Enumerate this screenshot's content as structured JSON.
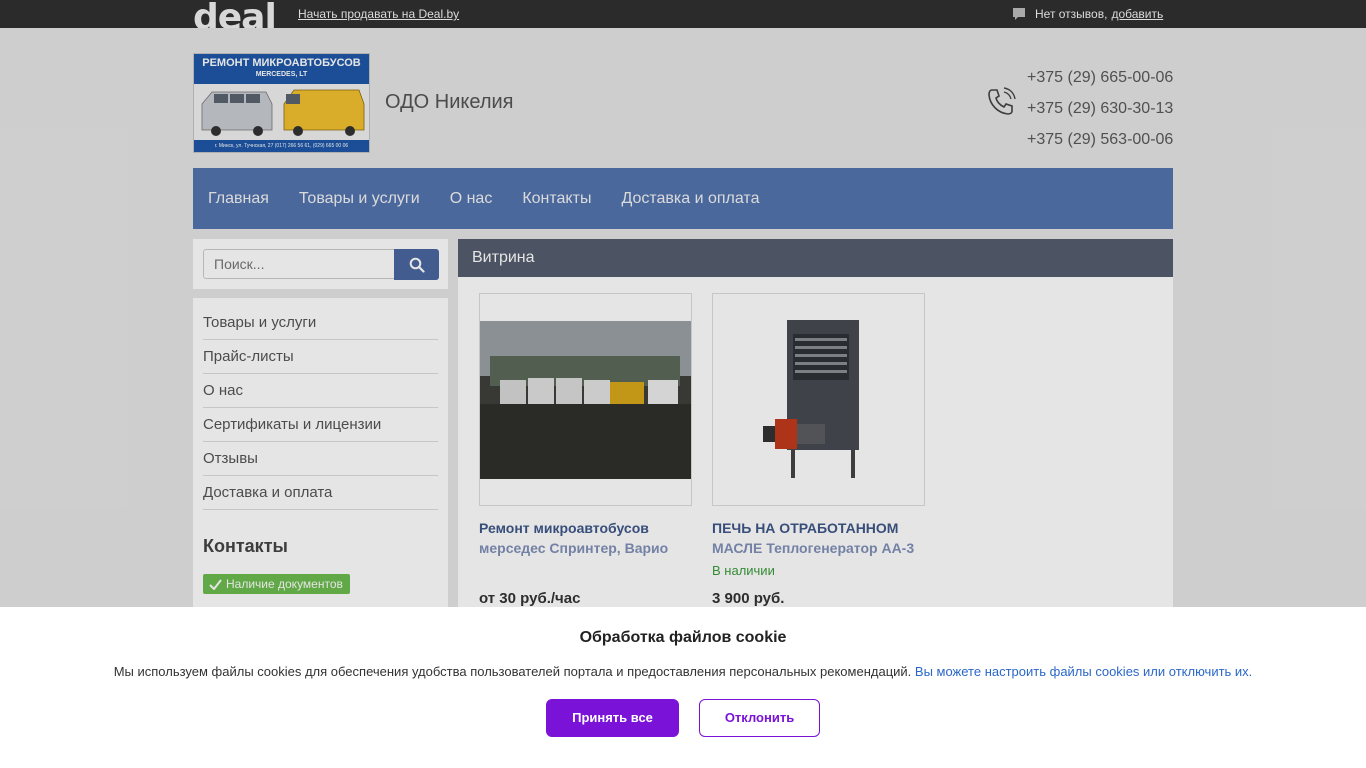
{
  "topbar": {
    "logo": "deal",
    "sell_link": "Начать продавать на Deal.by",
    "reviews_text": "Нет отзывов,",
    "reviews_add": "добавить"
  },
  "header": {
    "logo_banner": "РЕМОНТ МИКРОАВТОБУСОВ",
    "logo_sub": "MERCEDES, LT",
    "logo_footer": "г. Минск, ул. Тучнская, 27 (017) 266 56 61, (029) 665 00 06",
    "company_name": "ОДО Никелия",
    "phones": [
      "+375 (29) 665-00-06",
      "+375 (29) 630-30-13",
      "+375 (29) 563-00-06"
    ]
  },
  "nav": {
    "items": [
      "Главная",
      "Товары и услуги",
      "О нас",
      "Контакты",
      "Доставка и оплата"
    ]
  },
  "search": {
    "placeholder": "Поиск..."
  },
  "sidebar": {
    "items": [
      "Товары и услуги",
      "Прайс-листы",
      "О нас",
      "Сертификаты и лицензии",
      "Отзывы",
      "Доставка и оплата"
    ],
    "contacts_title": "Контакты",
    "doc_badge": "Наличие документов"
  },
  "main": {
    "title": "Витрина",
    "products": [
      {
        "title": "Ремонт микроавтобусов",
        "subtitle": "мерседес Спринтер, Варио",
        "stock": "",
        "price": "от 30 руб./час"
      },
      {
        "title": "ПЕЧЬ НА ОТРАБОТАННОМ",
        "subtitle": "МАСЛЕ Теплогенератор АА-3",
        "stock": "В наличии",
        "price": "3 900 руб."
      }
    ]
  },
  "cookie": {
    "title": "Обработка файлов cookie",
    "text": "Мы используем файлы cookies для обеспечения удобства пользователей портала и предоставления персональных рекомендаций.",
    "link": "Вы можете настроить файлы cookies или отключить их.",
    "accept": "Принять все",
    "decline": "Отклонить"
  },
  "colors": {
    "nav_bg": "#5374ae",
    "accent_purple": "#7a12d8",
    "stock_green": "#3a9b3a",
    "badge_green": "#6dbb4f"
  }
}
